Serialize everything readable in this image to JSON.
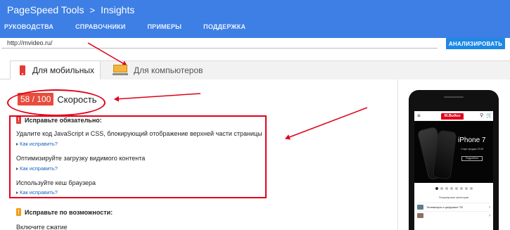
{
  "header": {
    "brand": "PageSpeed Tools",
    "separator": ">",
    "section": "Insights",
    "nav": [
      "РУКОВОДСТВА",
      "СПРАВОЧНИКИ",
      "ПРИМЕРЫ",
      "ПОДДЕРЖКА"
    ],
    "bg_color": "#3d7fe4"
  },
  "url_bar": {
    "value": "http://mvideo.ru/",
    "analyze_label": "АНАЛИЗИРОВАТЬ",
    "button_color": "#1e88e5"
  },
  "tabs": {
    "mobile": "Для мобильных",
    "desktop": "Для компьютеров",
    "active": "mobile"
  },
  "score": {
    "value": "58 / 100",
    "label": "Скорость",
    "color": "#e74c3c"
  },
  "must_fix": {
    "title": "Исправьте обязательно:",
    "icon": "exclamation-icon",
    "items": [
      {
        "text": "Удалите код JavaScript и CSS, блокирующий отображение верхней части страницы",
        "link": "Как исправить?"
      },
      {
        "text": "Оптимизируйте загрузку видимого контента",
        "link": "Как исправить?"
      },
      {
        "text": "Используйте кеш браузера",
        "link": "Как исправить?"
      }
    ]
  },
  "should_fix": {
    "title": "Исправьте по возможности:",
    "icon": "exclamation-icon",
    "items": [
      {
        "text": "Включите сжатие"
      }
    ]
  },
  "annotation_color": "#e1001a",
  "preview": {
    "logo": "М.Видео",
    "hero_title": "iPhone 7",
    "hero_sub": "Старт продаж 23.09",
    "hero_button": "Подробнее",
    "categories_title": "Популярные категории",
    "categories": [
      "Телевизоры и цифровое ТВ",
      ""
    ]
  }
}
